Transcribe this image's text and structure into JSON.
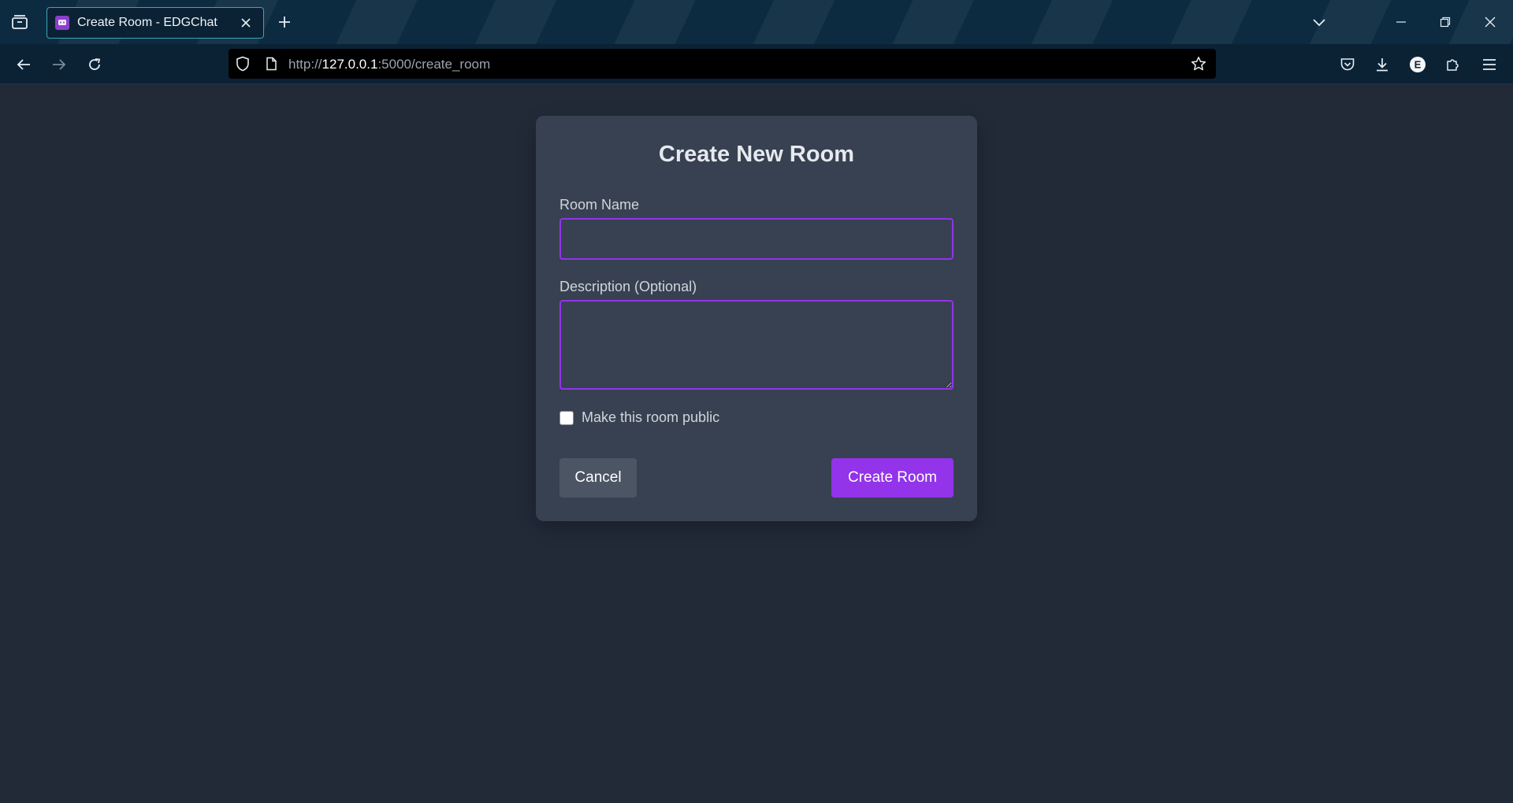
{
  "browser": {
    "tab_title": "Create Room - EDGChat",
    "url_scheme": "http://",
    "url_host": "127.0.0.1",
    "url_rest": ":5000/create_room",
    "extension_letter": "E"
  },
  "form": {
    "heading": "Create New Room",
    "room_name_label": "Room Name",
    "room_name_value": "",
    "description_label": "Description (Optional)",
    "description_value": "",
    "public_label": "Make this room public",
    "public_checked": false,
    "cancel_label": "Cancel",
    "create_label": "Create Room"
  },
  "colors": {
    "accent": "#9333ea",
    "card": "#374151",
    "page_bg": "#222a38",
    "cancel_bg": "#4b5563"
  }
}
